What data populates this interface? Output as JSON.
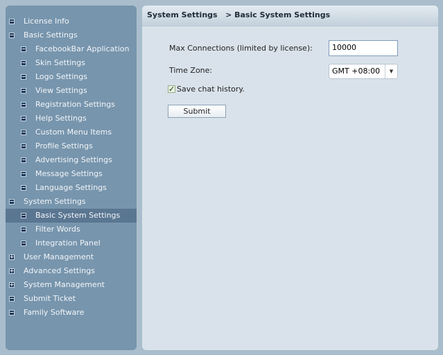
{
  "sidebar": {
    "items": [
      {
        "label": "License Info",
        "level": 0,
        "icon": "minus"
      },
      {
        "label": "Basic Settings",
        "level": 0,
        "icon": "minus"
      },
      {
        "label": "FacebookBar Application",
        "level": 1,
        "icon": "minus"
      },
      {
        "label": "Skin Settings",
        "level": 1,
        "icon": "minus"
      },
      {
        "label": "Logo Settings",
        "level": 1,
        "icon": "minus"
      },
      {
        "label": "View Settings",
        "level": 1,
        "icon": "minus"
      },
      {
        "label": "Registration Settings",
        "level": 1,
        "icon": "minus"
      },
      {
        "label": "Help Settings",
        "level": 1,
        "icon": "minus"
      },
      {
        "label": "Custom Menu Items",
        "level": 1,
        "icon": "minus"
      },
      {
        "label": "Profile Settings",
        "level": 1,
        "icon": "minus"
      },
      {
        "label": "Advertising Settings",
        "level": 1,
        "icon": "minus"
      },
      {
        "label": "Message Settings",
        "level": 1,
        "icon": "minus"
      },
      {
        "label": "Language Settings",
        "level": 1,
        "icon": "minus"
      },
      {
        "label": "System Settings",
        "level": 0,
        "icon": "minus"
      },
      {
        "label": "Basic System Settings",
        "level": 1,
        "icon": "minus",
        "selected": true
      },
      {
        "label": "Filter Words",
        "level": 1,
        "icon": "minus"
      },
      {
        "label": "Integration Panel",
        "level": 1,
        "icon": "minus"
      },
      {
        "label": "User Management",
        "level": 0,
        "icon": "plus"
      },
      {
        "label": "Advanced Settings",
        "level": 0,
        "icon": "plus"
      },
      {
        "label": "System Management",
        "level": 0,
        "icon": "plus"
      },
      {
        "label": "Submit Ticket",
        "level": 0,
        "icon": "minus"
      },
      {
        "label": "Family Software",
        "level": 0,
        "icon": "minus"
      }
    ]
  },
  "header": {
    "section": "System Settings",
    "page": "> Basic System Settings"
  },
  "form": {
    "max_connections_label": "Max Connections (limited by license):",
    "max_connections_value": "10000",
    "time_zone_label": "Time Zone:",
    "time_zone_value": "GMT +08:00",
    "save_history_label": "Save chat history.",
    "save_history_checked": true,
    "submit_label": "Submit"
  }
}
